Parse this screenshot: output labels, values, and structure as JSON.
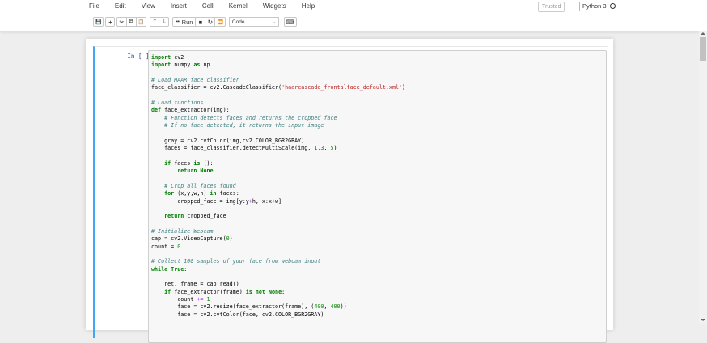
{
  "menu": [
    "File",
    "Edit",
    "View",
    "Insert",
    "Cell",
    "Kernel",
    "Widgets",
    "Help"
  ],
  "header": {
    "trusted": "Trusted",
    "kernel_name": "Python 3"
  },
  "toolbar": {
    "save_icon": "💾",
    "add_icon": "+",
    "cut_icon": "✂",
    "copy_icon": "⧉",
    "paste_icon": "📋",
    "up_icon": "🡑",
    "down_icon": "🡓",
    "run_label": "Run",
    "run_icon": "⏭",
    "stop_icon": "■",
    "restart_icon": "↻",
    "fastforward_icon": "⏩",
    "cell_type": "Code",
    "cell_type_chevron": "⌄",
    "keyboard_icon": "⌨"
  },
  "cell": {
    "prompt": "In [ ]:",
    "code_lines": [
      "import cv2",
      "import numpy as np",
      "",
      "# Load HAAR face classifier",
      "face_classifier = cv2.CascadeClassifier('haarcascade_frontalface_default.xml')",
      "",
      "# Load functions",
      "def face_extractor(img):",
      "    # Function detects faces and returns the cropped face",
      "    # If no face detected, it returns the input image",
      "",
      "    gray = cv2.cvtColor(img,cv2.COLOR_BGR2GRAY)",
      "    faces = face_classifier.detectMultiScale(img, 1.3, 5)",
      "",
      "    if faces is ():",
      "        return None",
      "",
      "    # Crop all faces found",
      "    for (x,y,w,h) in faces:",
      "        cropped_face = img[y:y+h, x:x+w]",
      "",
      "    return cropped_face",
      "",
      "# Initialize Webcam",
      "cap = cv2.VideoCapture(0)",
      "count = 0",
      "",
      "# Collect 100 samples of your face from webcam input",
      "while True:",
      "",
      "    ret, frame = cap.read()",
      "    if face_extractor(frame) is not None:",
      "        count += 1",
      "        face = cv2.resize(face_extractor(frame), (400, 400))",
      "        face = cv2.cvtColor(face, cv2.COLOR_BGR2GRAY)"
    ]
  },
  "colors": {
    "selected_cell_border": "#42a5f5",
    "prompt": "#303f9f",
    "keyword": "#008000",
    "comment": "#408080",
    "string": "#ba2121"
  }
}
